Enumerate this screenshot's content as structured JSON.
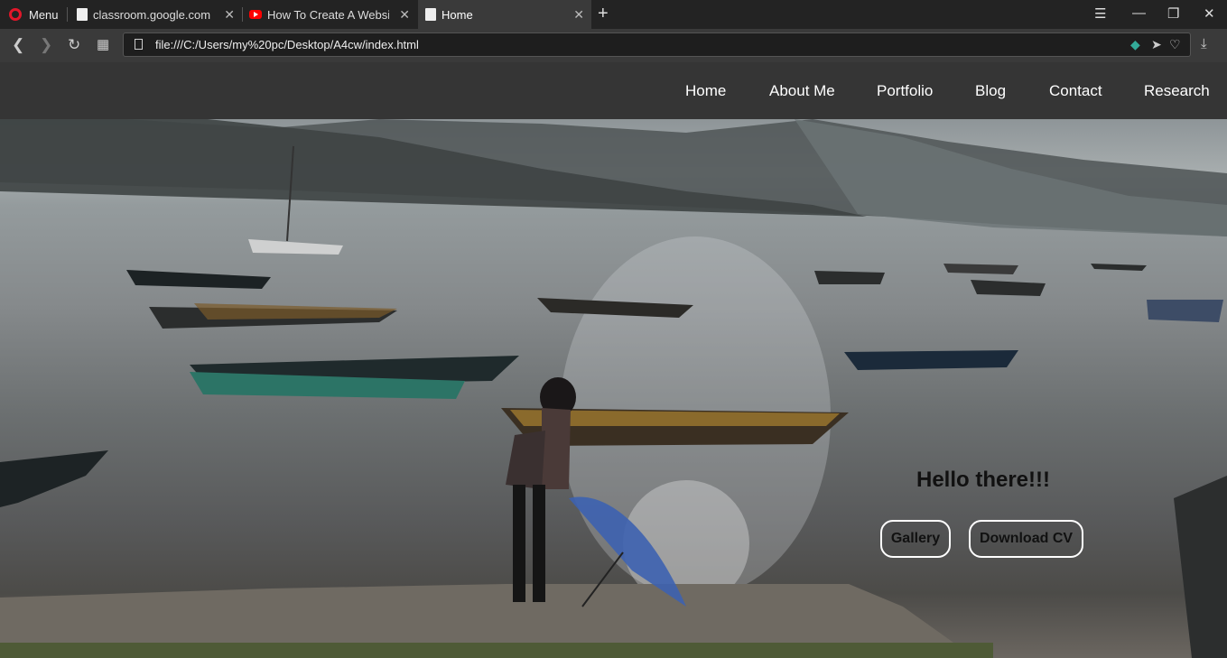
{
  "browser": {
    "menu_label": "Menu",
    "tabs": [
      {
        "title": "classroom.google.com",
        "icon": "document-icon"
      },
      {
        "title": "How To Create A Website",
        "icon": "youtube-icon"
      },
      {
        "title": "Home",
        "icon": "document-icon",
        "active": true
      }
    ],
    "url": "file:///C:/Users/my%20pc/Desktop/A4cw/index.html"
  },
  "site": {
    "nav": [
      "Home",
      "About Me",
      "Portfolio",
      "Blog",
      "Contact",
      "Research"
    ],
    "hero": {
      "greeting": "Hello there!!!",
      "gallery_button": "Gallery",
      "cv_button": "Download CV"
    }
  },
  "colors": {
    "header_bg": "#353535",
    "button_border": "#ffffff",
    "opera_red": "#e2172a"
  }
}
